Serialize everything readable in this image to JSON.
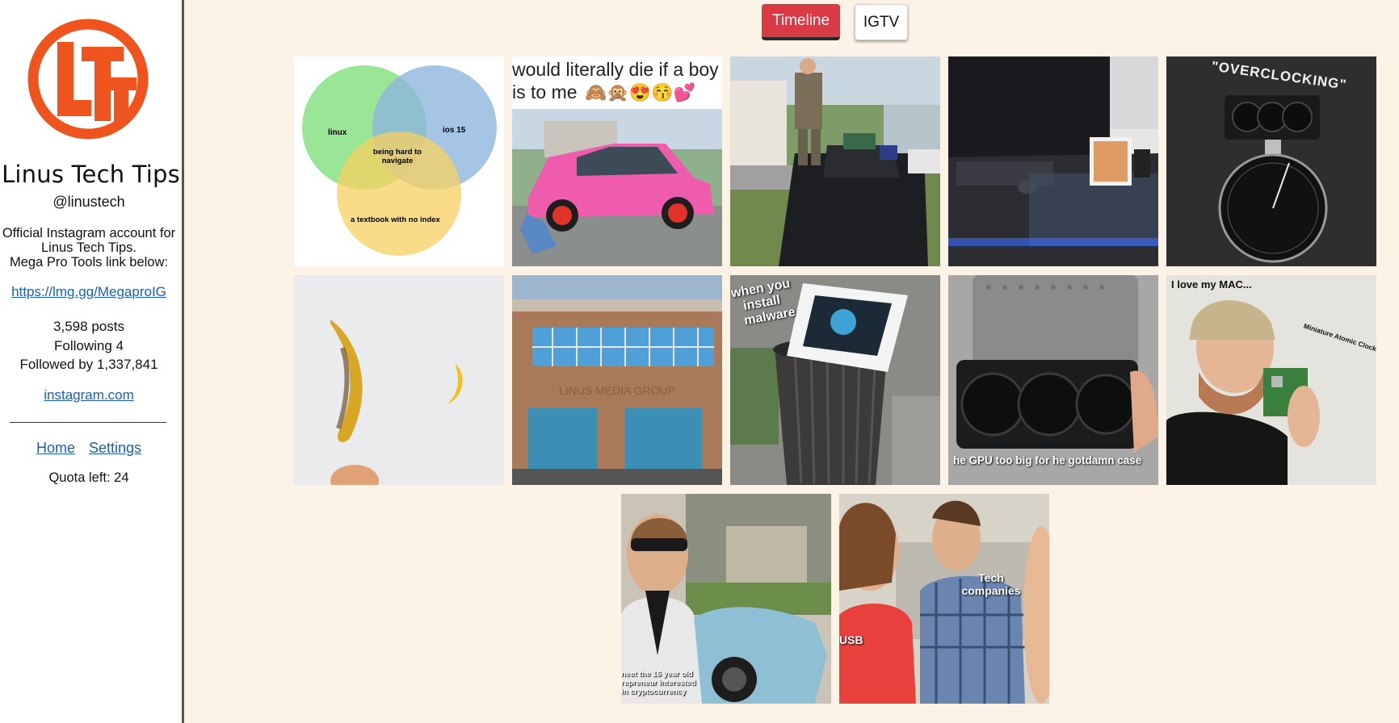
{
  "profile": {
    "name": "Linus Tech Tips",
    "handle": "@linustech",
    "bio_line1": "Official Instagram account for",
    "bio_line2": "Linus Tech Tips.",
    "bio_line3": "Mega Pro Tools link below:",
    "bio_link": "https://lmg.gg/MegaproIG",
    "posts_count": "3,598",
    "posts_label": "posts",
    "following_label": "Following",
    "following_count": "4",
    "followers_label": "Followed by",
    "followers_count": "1,337,841",
    "site_link": "instagram.com",
    "logo_icon": "ltt-logo-icon",
    "logo_color": "#f0541e"
  },
  "nav": {
    "home": "Home",
    "settings": "Settings",
    "quota": "Quota left: 24"
  },
  "tabs": {
    "timeline": "Timeline",
    "igtv": "IGTV",
    "active_color": "#d93a45"
  },
  "posts": [
    {
      "venn_a": "linux",
      "venn_b": "ios 15",
      "venn_ab": "being hard to navigate",
      "venn_c": "a textbook with no index"
    },
    {
      "caption_line1": "would literally die if a boy c",
      "caption_line2": "is to me"
    },
    {},
    {},
    {
      "caption": "\"OVERCLOCKING\""
    },
    {},
    {
      "sign": "LINUS MEDIA GROUP"
    },
    {
      "caption_line1": "when you",
      "caption_line2": "install",
      "caption_line3": "malware"
    },
    {
      "caption": "he GPU too big for he gotdamn case"
    },
    {
      "caption": "I love my MAC...",
      "label": "Miniature Atomic Clock"
    },
    {
      "caption_line1": "neet the 16 year old",
      "caption_line2": "repreneur interested",
      "caption_line3": "in cryptocurrency"
    },
    {
      "label_left": "USB",
      "label_right_line1": "Tech",
      "label_right_line2": "companies"
    }
  ]
}
